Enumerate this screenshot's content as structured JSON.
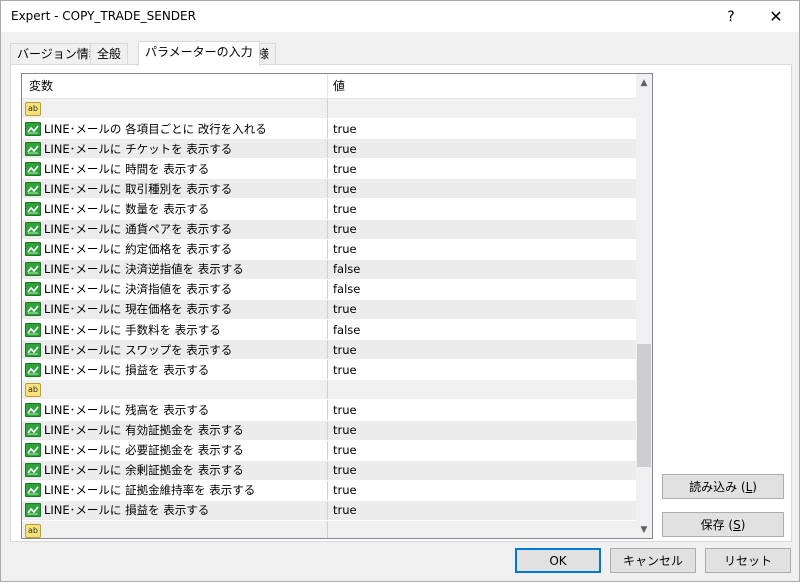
{
  "window": {
    "title": "Expert - COPY_TRADE_SENDER",
    "help_glyph": "?",
    "close_glyph": "✕"
  },
  "tabs": [
    {
      "label": "バージョン情報"
    },
    {
      "label": "全般"
    },
    {
      "label": "パラメーターの入力"
    },
    {
      "label": "仕様"
    }
  ],
  "grid": {
    "columns": {
      "variable": "変数",
      "value": "値"
    },
    "rows": [
      {
        "type": "group",
        "icon": "ab-icon",
        "label": "",
        "value": ""
      },
      {
        "type": "bool",
        "icon": "bool-icon",
        "label": "LINE･メールの 各項目ごとに 改行を入れる",
        "value": "true"
      },
      {
        "type": "bool",
        "icon": "bool-icon",
        "label": "LINE･メールに チケットを 表示する",
        "value": "true"
      },
      {
        "type": "bool",
        "icon": "bool-icon",
        "label": "LINE･メールに 時間を 表示する",
        "value": "true"
      },
      {
        "type": "bool",
        "icon": "bool-icon",
        "label": "LINE･メールに 取引種別を 表示する",
        "value": "true"
      },
      {
        "type": "bool",
        "icon": "bool-icon",
        "label": "LINE･メールに 数量を 表示する",
        "value": "true"
      },
      {
        "type": "bool",
        "icon": "bool-icon",
        "label": "LINE･メールに 通貨ペアを 表示する",
        "value": "true"
      },
      {
        "type": "bool",
        "icon": "bool-icon",
        "label": "LINE･メールに 約定価格を 表示する",
        "value": "true"
      },
      {
        "type": "bool",
        "icon": "bool-icon",
        "label": "LINE･メールに 決済逆指値を 表示する",
        "value": "false"
      },
      {
        "type": "bool",
        "icon": "bool-icon",
        "label": "LINE･メールに 決済指値を 表示する",
        "value": "false"
      },
      {
        "type": "bool",
        "icon": "bool-icon",
        "label": "LINE･メールに 現在価格を 表示する",
        "value": "true"
      },
      {
        "type": "bool",
        "icon": "bool-icon",
        "label": "LINE･メールに 手数料を 表示する",
        "value": "false"
      },
      {
        "type": "bool",
        "icon": "bool-icon",
        "label": "LINE･メールに スワップを 表示する",
        "value": "true"
      },
      {
        "type": "bool",
        "icon": "bool-icon",
        "label": "LINE･メールに 損益を 表示する",
        "value": "true"
      },
      {
        "type": "group",
        "icon": "ab-icon",
        "label": "",
        "value": ""
      },
      {
        "type": "bool",
        "icon": "bool-icon",
        "label": "LINE･メールに 残高を 表示する",
        "value": "true"
      },
      {
        "type": "bool",
        "icon": "bool-icon",
        "label": "LINE･メールに 有効証拠金を 表示する",
        "value": "true"
      },
      {
        "type": "bool",
        "icon": "bool-icon",
        "label": "LINE･メールに 必要証拠金を 表示する",
        "value": "true"
      },
      {
        "type": "bool",
        "icon": "bool-icon",
        "label": "LINE･メールに 余剰証拠金を 表示する",
        "value": "true"
      },
      {
        "type": "bool",
        "icon": "bool-icon",
        "label": "LINE･メールに 証拠金維持率を 表示する",
        "value": "true"
      },
      {
        "type": "bool",
        "icon": "bool-icon",
        "label": "LINE･メールに 損益を 表示する",
        "value": "true"
      },
      {
        "type": "group",
        "icon": "ab-icon",
        "label": "",
        "value": ""
      }
    ]
  },
  "side_buttons": {
    "load": {
      "label": "読み込み (",
      "key": "L",
      "close": ")"
    },
    "save": {
      "label": "保存 (",
      "key": "S",
      "close": ")"
    }
  },
  "footer": {
    "ok": "OK",
    "cancel": "キャンセル",
    "reset": "リセット"
  },
  "colors": {
    "bool_icon": "#2fa33a",
    "ab_icon": "#f6e27a",
    "ok_border": "#0078d7"
  }
}
